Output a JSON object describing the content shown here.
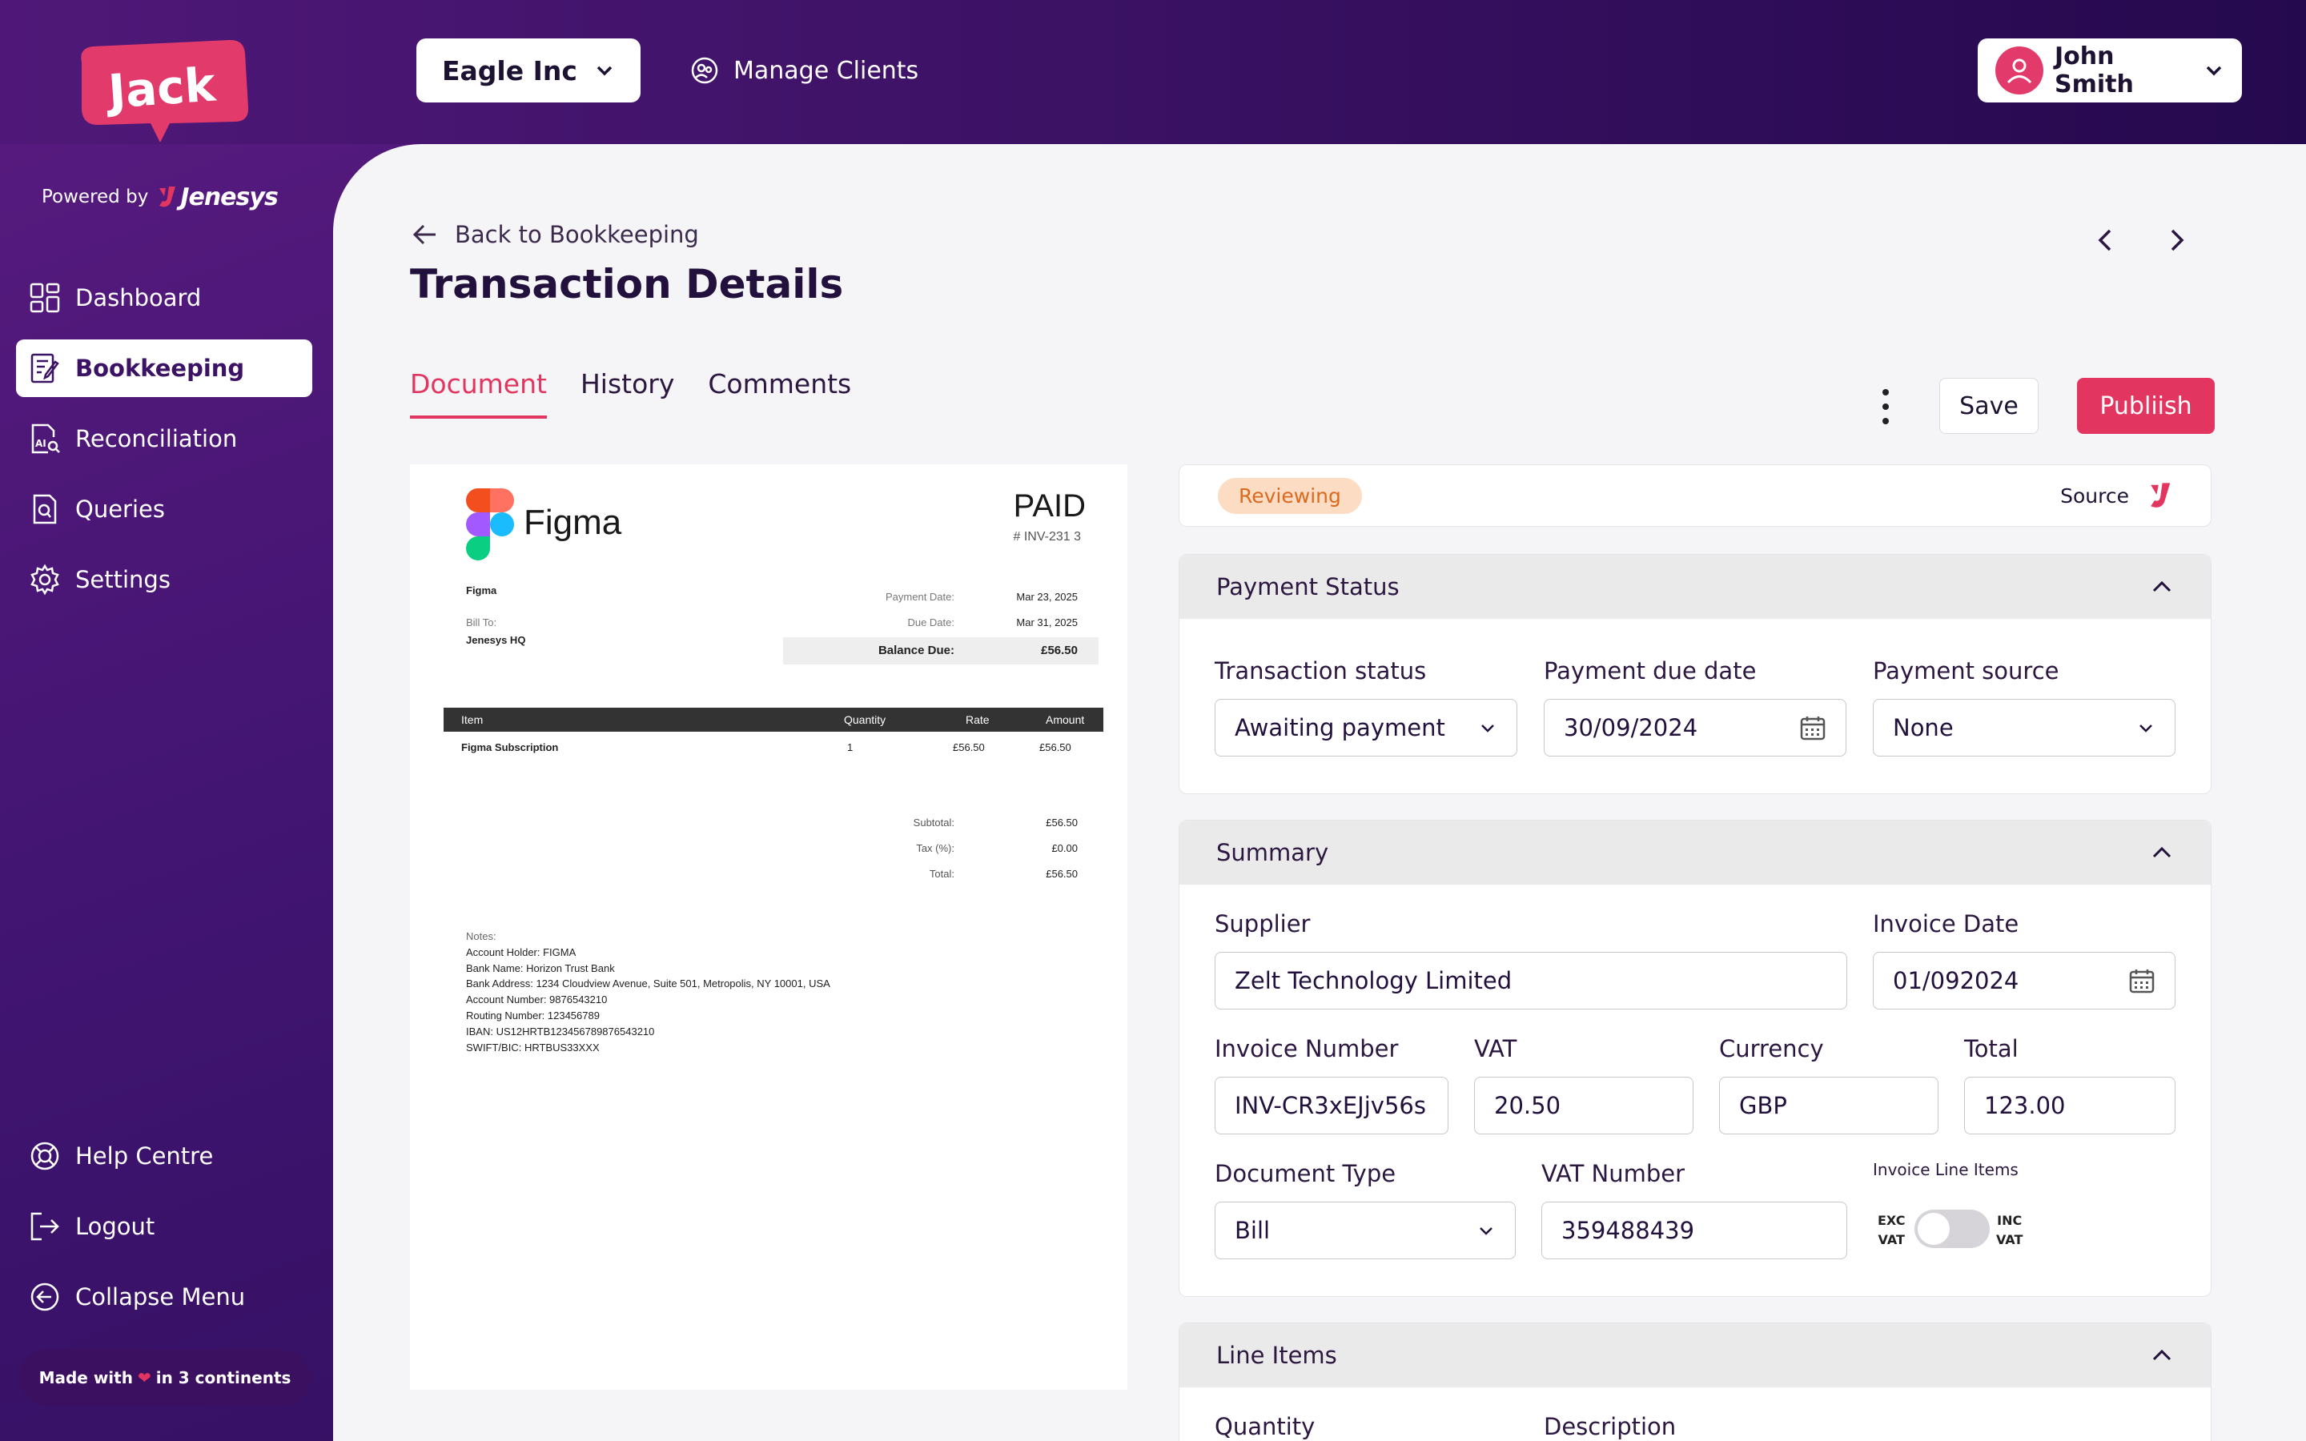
{
  "app": {
    "name": "Jack",
    "powered_by": "Powered by",
    "powered_brand": "Jenesys"
  },
  "sidebar": {
    "items": [
      {
        "label": "Dashboard",
        "icon": "dashboard-icon"
      },
      {
        "label": "Bookkeeping",
        "icon": "bookkeeping-icon",
        "active": true
      },
      {
        "label": "Reconciliation",
        "icon": "reconciliation-icon"
      },
      {
        "label": "Queries",
        "icon": "queries-icon"
      },
      {
        "label": "Settings",
        "icon": "gear-icon"
      }
    ],
    "bottom": [
      {
        "label": "Help Centre",
        "icon": "lifebuoy-icon"
      },
      {
        "label": "Logout",
        "icon": "logout-icon"
      },
      {
        "label": "Collapse Menu",
        "icon": "collapse-icon"
      }
    ],
    "made_with": {
      "pre": "Made with",
      "post": "in 3 continents"
    }
  },
  "topbar": {
    "company": "Eagle Inc",
    "manage": "Manage Clients",
    "user": "John Smith"
  },
  "page": {
    "back": "Back to Bookkeeping",
    "title": "Transaction Details",
    "tabs": [
      "Document",
      "History",
      "Comments"
    ],
    "save": "Save",
    "publish": "Publiish"
  },
  "document": {
    "brand": "Figma",
    "status": "PAID",
    "invoice_no": "# INV-231 3",
    "from": "Figma",
    "bill_to_label": "Bill To:",
    "bill_to": "Jenesys HQ",
    "payment_date_label": "Payment Date:",
    "payment_date": "Mar 23, 2025",
    "due_date_label": "Due Date:",
    "due_date": "Mar 31, 2025",
    "balance_label": "Balance Due:",
    "balance": "£56.50",
    "headers": [
      "Item",
      "Quantity",
      "Rate",
      "Amount"
    ],
    "rows": [
      {
        "item": "Figma Subscription",
        "qty": "1",
        "rate": "£56.50",
        "amount": "£56.50"
      }
    ],
    "subtotal_label": "Subtotal:",
    "subtotal": "£56.50",
    "tax_label": "Tax (%):",
    "tax": "£0.00",
    "total_label": "Total:",
    "total": "£56.50",
    "notes_title": "Notes:",
    "notes": [
      "Account Holder: FIGMA",
      "Bank Name: Horizon Trust Bank",
      "Bank Address: 1234 Cloudview Avenue, Suite 501, Metropolis, NY 10001, USA",
      "Account Number: 9876543210",
      "Routing Number: 123456789",
      "IBAN: US12HRTB123456789876543210",
      "SWIFT/BIC: HRTBUS33XXX"
    ]
  },
  "status": {
    "badge": "Reviewing",
    "source": "Source"
  },
  "payment": {
    "title": "Payment Status",
    "transaction_status_label": "Transaction status",
    "transaction_status": "Awaiting payment",
    "due_label": "Payment due date",
    "due": "30/09/2024",
    "source_label": "Payment source",
    "source": "None"
  },
  "summary": {
    "title": "Summary",
    "supplier_label": "Supplier",
    "supplier": "Zelt Technology Limited",
    "invoice_date_label": "Invoice Date",
    "invoice_date": "01/092024",
    "invoice_number_label": "Invoice Number",
    "invoice_number": "INV-CR3xEJjv56s",
    "vat_label": "VAT",
    "vat": "20.50",
    "currency_label": "Currency",
    "currency": "GBP",
    "total_label": "Total",
    "total": "123.00",
    "doc_type_label": "Document Type",
    "doc_type": "Bill",
    "vat_number_label": "VAT Number",
    "vat_number": "359488439",
    "line_items_label": "Invoice Line Items",
    "exc": "EXC",
    "inc": "INC",
    "vat_small": "VAT"
  },
  "line_items": {
    "title": "Line Items",
    "quantity_label": "Quantity",
    "description_label": "Description"
  },
  "colors": {
    "accent": "#e2355f",
    "purple": "#3c1265",
    "badge_bg": "#fddcc4",
    "badge_text": "#d96a1f"
  }
}
